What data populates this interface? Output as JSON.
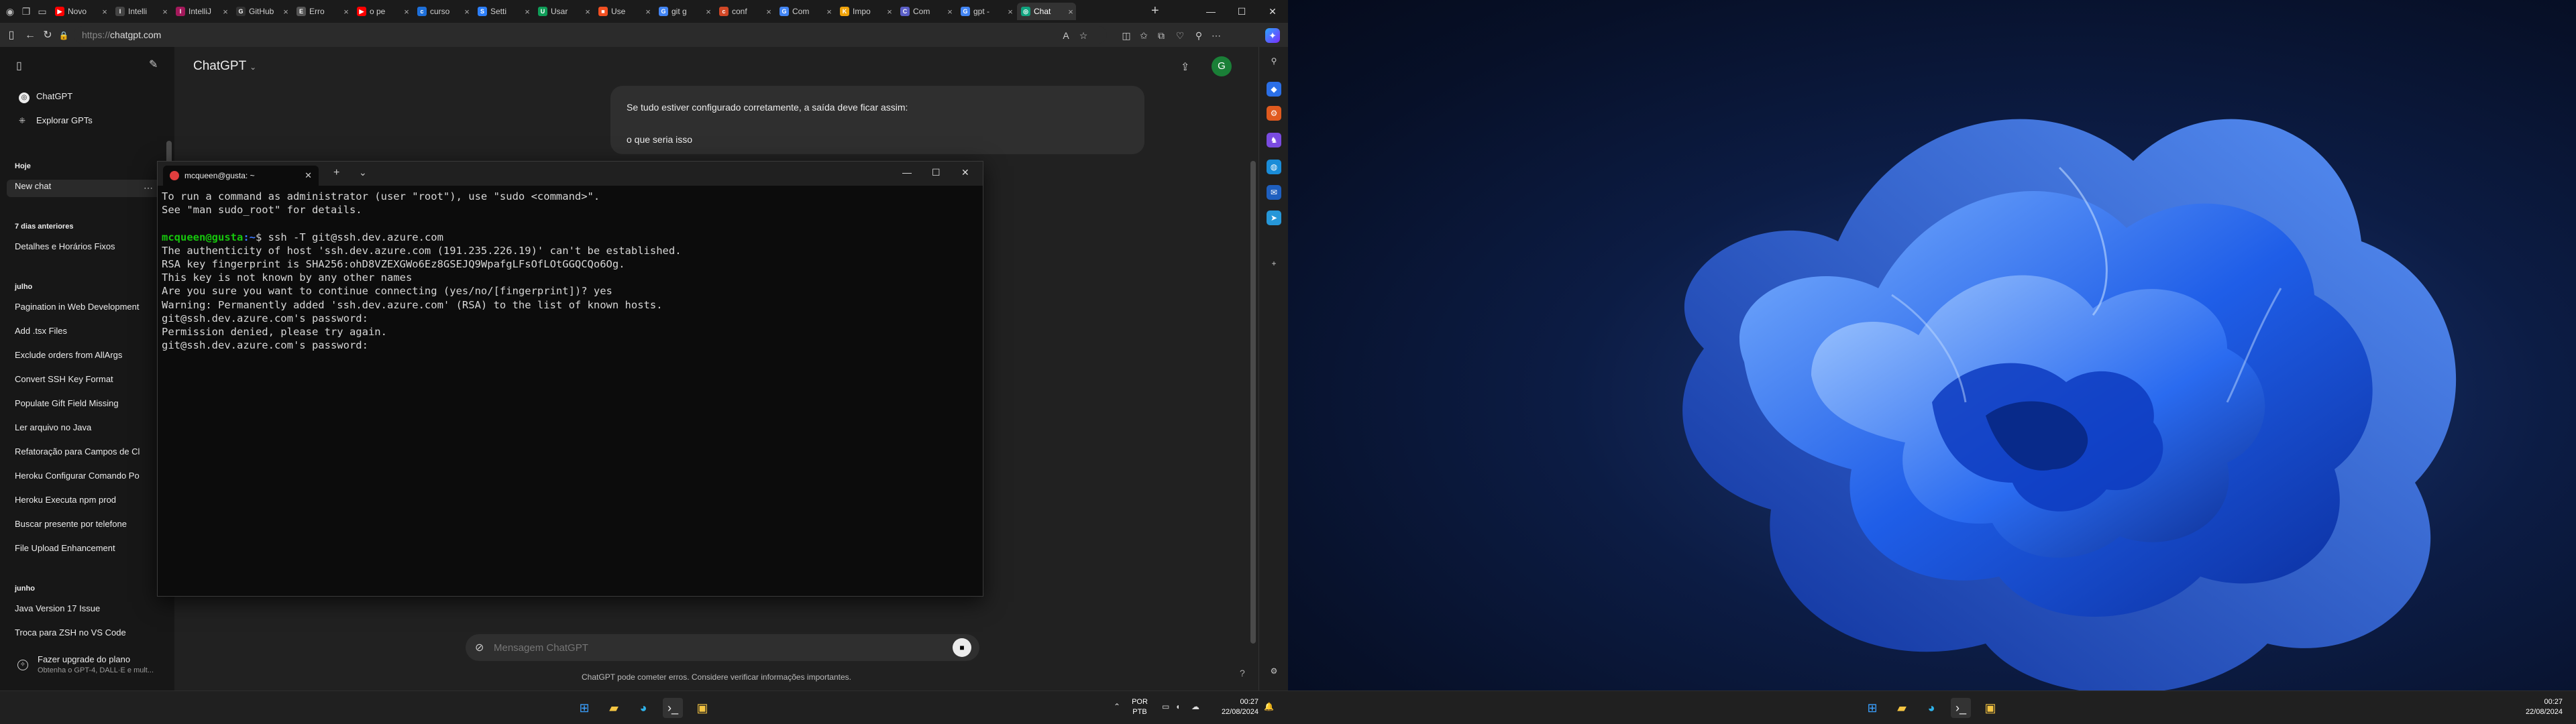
{
  "browser": {
    "tabs": [
      {
        "label": "Novo",
        "color": "#ff0000",
        "glyph": "▶"
      },
      {
        "label": "Intelli",
        "color": "#444444",
        "glyph": "I"
      },
      {
        "label": "IntelliJ",
        "color": "#a3195b",
        "glyph": "I"
      },
      {
        "label": "GitHub",
        "color": "#333333",
        "glyph": "G"
      },
      {
        "label": "Erro",
        "color": "#555555",
        "glyph": "E"
      },
      {
        "label": "o pe",
        "color": "#ff0000",
        "glyph": "▶"
      },
      {
        "label": "curso",
        "color": "#1e6fd9",
        "glyph": "c"
      },
      {
        "label": "Setti",
        "color": "#2d7ff9",
        "glyph": "S"
      },
      {
        "label": "Usar",
        "color": "#0f9d58",
        "glyph": "U"
      },
      {
        "label": "Use",
        "color": "#f25022",
        "glyph": "■"
      },
      {
        "label": "git g",
        "color": "#4285f4",
        "glyph": "G"
      },
      {
        "label": "conf",
        "color": "#d24726",
        "glyph": "c"
      },
      {
        "label": "Com",
        "color": "#4285f4",
        "glyph": "G"
      },
      {
        "label": "Impo",
        "color": "#f0a30a",
        "glyph": "K"
      },
      {
        "label": "Com",
        "color": "#5b5fc7",
        "glyph": "C"
      },
      {
        "label": "gpt -",
        "color": "#4285f4",
        "glyph": "G"
      },
      {
        "label": "Chat",
        "color": "#10a37f",
        "glyph": "◎"
      }
    ],
    "url_protocol": "https://",
    "url_host": "chatgpt.com"
  },
  "chatgpt": {
    "sidebar": {
      "top_items": [
        {
          "label": "ChatGPT",
          "icon": "chatgpt-logo-icon"
        },
        {
          "label": "Explorar GPTs",
          "icon": "grid-icon"
        }
      ],
      "sections": [
        {
          "heading": "Hoje",
          "items": [
            "New chat"
          ]
        },
        {
          "heading": "7 dias anteriores",
          "items": [
            "Detalhes e Horários Fixos"
          ]
        },
        {
          "heading": "julho",
          "items": [
            "Pagination in Web Development",
            "Add .tsx Files",
            "Exclude orders from AllArgs",
            "Convert SSH Key Format",
            "Populate Gift Field Missing",
            "Ler arquivo no Java",
            "Refatoração para Campos de Cl",
            "Heroku Configurar Comando Po",
            "Heroku Executa npm prod",
            "Buscar presente por telefone",
            "File Upload Enhancement"
          ]
        },
        {
          "heading": "junho",
          "items": [
            "Java Version 17 Issue",
            "Troca para ZSH no VS Code"
          ]
        }
      ],
      "upgrade_title": "Fazer upgrade do plano",
      "upgrade_sub": "Obtenha o GPT-4, DALL·E e mult..."
    },
    "model_label": "ChatGPT",
    "avatar_letter": "G",
    "message_lines": [
      "Se tudo estiver configurado corretamente, a saída deve ficar assim:",
      "o que seria isso"
    ],
    "input_placeholder": "Mensagem ChatGPT",
    "footer": "ChatGPT pode cometer erros. Considere verificar informações importantes."
  },
  "terminal": {
    "tab_title": "mcqueen@gusta: ~",
    "lines": [
      "To run a command as administrator (user \"root\"), use \"sudo <command>\".",
      "See \"man sudo_root\" for details.",
      "",
      "$ ssh -T git@ssh.dev.azure.com",
      "The authenticity of host 'ssh.dev.azure.com (191.235.226.19)' can't be established.",
      "RSA key fingerprint is SHA256:ohD8VZEXGWo6Ez8GSEJQ9WpafgLFsOfLOtGGQCQo6Og.",
      "This key is not known by any other names",
      "Are you sure you want to continue connecting (yes/no/[fingerprint])? yes",
      "Warning: Permanently added 'ssh.dev.azure.com' (RSA) to the list of known hosts.",
      "git@ssh.dev.azure.com's password:",
      "Permission denied, please try again.",
      "git@ssh.dev.azure.com's password:"
    ],
    "prompt_user": "mcqueen@gusta",
    "prompt_path": ":~"
  },
  "taskbar_left": {
    "lang_top": "POR",
    "lang_bottom": "PTB",
    "time": "00:27",
    "date": "22/08/2024"
  },
  "taskbar_right": {
    "time": "00:27",
    "date": "22/08/2024"
  }
}
